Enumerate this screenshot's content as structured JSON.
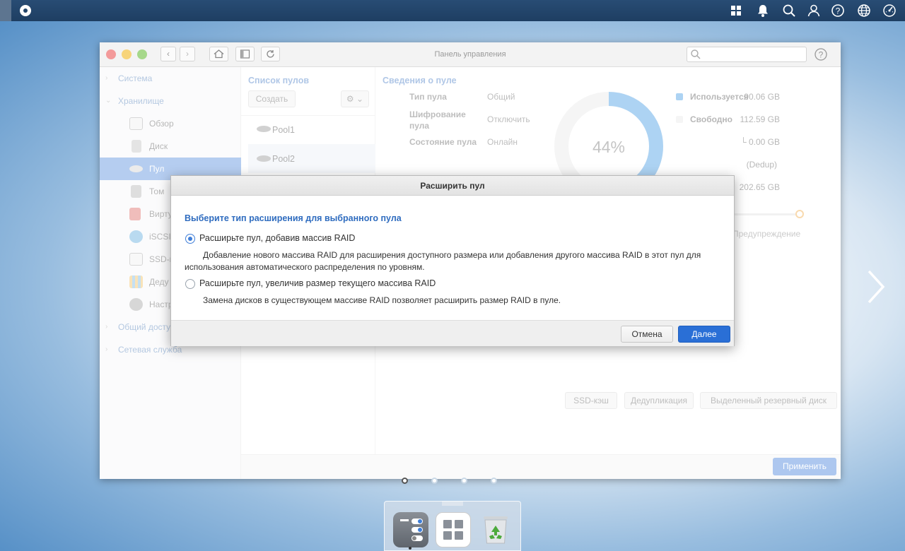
{
  "window": {
    "title": "Панель управления"
  },
  "sidebar": {
    "sections": [
      {
        "label": "Система"
      },
      {
        "label": "Хранилище"
      },
      {
        "label": "Общий досту"
      },
      {
        "label": "Сетевая служба"
      }
    ],
    "items": [
      {
        "label": "Обзор"
      },
      {
        "label": "Диск"
      },
      {
        "label": "Пул"
      },
      {
        "label": "Том"
      },
      {
        "label": "Вирту"
      },
      {
        "label": "iSCSI"
      },
      {
        "label": "SSD-к"
      },
      {
        "label": "Деду"
      },
      {
        "label": "Настр"
      }
    ]
  },
  "pools": {
    "title": "Список пулов",
    "create_label": "Создать",
    "list": [
      "Pool1",
      "Pool2"
    ]
  },
  "info": {
    "title": "Сведения о пуле",
    "rows": [
      {
        "label": "Тип пула",
        "value": "Общий"
      },
      {
        "label": "Шифрование пула",
        "value": "Отключить"
      },
      {
        "label": "Состояние пула",
        "value": "Онлайн"
      }
    ],
    "percent": "44%",
    "used_fraction": 0.44,
    "legend": [
      {
        "label": "Используется",
        "value": "90.06 GB"
      },
      {
        "label": "Свободно",
        "value": "112.59 GB"
      },
      {
        "label": "",
        "value": "└ 0.00 GB"
      },
      {
        "label": "",
        "value": "(Dedup)"
      },
      {
        "label": "",
        "value": "202.65 GB"
      }
    ],
    "warning_label": "Предупреждение",
    "buttons": [
      "SSD-кэш",
      "Дедупликация",
      "Выделенный резервный диск"
    ],
    "apply_label": "Применить"
  },
  "dialog": {
    "title": "Расширить пул",
    "question": "Выберите тип расширения для выбранного пула",
    "options": [
      {
        "label": "Расширьте пул, добавив массив RAID",
        "desc1": "Добавление нового массива RAID для расширения доступного размера или добавления другого массива RAID в этот пул для",
        "desc2": "использования автоматического распределения по уровням.",
        "selected": true
      },
      {
        "label": "Расширьте пул, увеличив размер текущего массива RAID",
        "desc1": "Замена дисков в существующем массиве RAID позволяет расширить размер RAID в пуле.",
        "selected": false
      }
    ],
    "cancel_label": "Отмена",
    "next_label": "Далее"
  },
  "colors": {
    "accent": "#3f7ed8",
    "topbar": "#23456a",
    "primary_button": "#2a6fd6"
  },
  "icons": [
    "grid-icon",
    "bell-icon",
    "search-icon",
    "user-icon",
    "help-icon",
    "globe-icon",
    "dashboard-icon",
    "chevron-right-icon"
  ]
}
